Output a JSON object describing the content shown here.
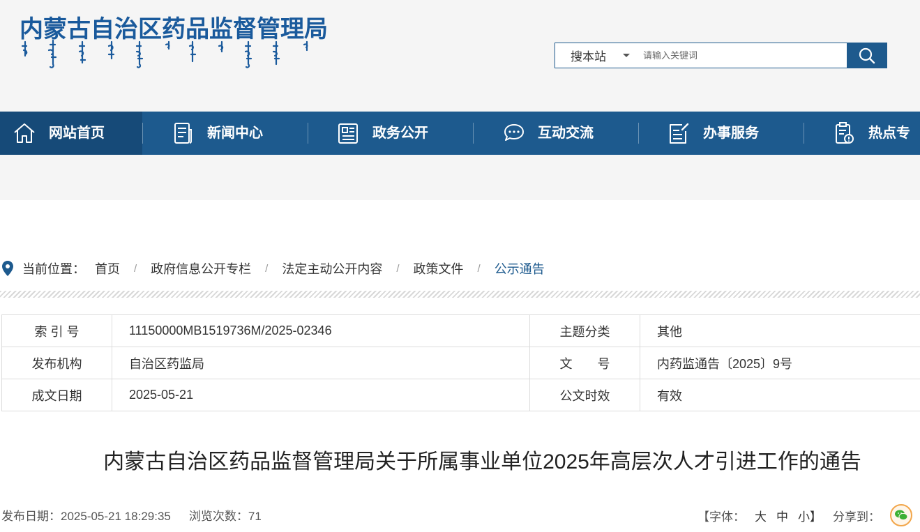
{
  "header": {
    "logo_text": "内蒙古自治区药品监督管理局",
    "search": {
      "scope_label": "搜本站",
      "placeholder": "请输入关键词"
    }
  },
  "nav": {
    "items": [
      {
        "label": "网站首页",
        "icon": "home-icon"
      },
      {
        "label": "新闻中心",
        "icon": "newspaper-icon"
      },
      {
        "label": "政务公开",
        "icon": "document-icon"
      },
      {
        "label": "互动交流",
        "icon": "chat-icon"
      },
      {
        "label": "办事服务",
        "icon": "edit-form-icon"
      },
      {
        "label": "热点专",
        "icon": "clipboard-alert-icon"
      }
    ]
  },
  "breadcrumb": {
    "label": "当前位置：",
    "items": [
      "首页",
      "政府信息公开专栏",
      "法定主动公开内容",
      "政策文件",
      "公示通告"
    ]
  },
  "info_table": {
    "rows": [
      {
        "k1": "索 引 号",
        "v1": "11150000MB1519736M/2025-02346",
        "k2": "主题分类",
        "v2": "其他"
      },
      {
        "k1": "发布机构",
        "v1": "自治区药监局",
        "k2": "文　　号",
        "v2": "内药监通告〔2025〕9号"
      },
      {
        "k1": "成文日期",
        "v1": "2025-05-21",
        "k2": "公文时效",
        "v2": "有效"
      }
    ]
  },
  "article": {
    "title": "内蒙古自治区药品监督管理局关于所属事业单位2025年高层次人才引进工作的通告",
    "publish_label": "发布日期：",
    "publish_value": "2025-05-21 18:29:35",
    "views_label": "浏览次数：",
    "views_value": "71"
  },
  "tools": {
    "font_label": "【字体：",
    "font_large": "大",
    "font_medium": "中",
    "font_small": "小】",
    "share_label": "分享到："
  },
  "colors": {
    "brand_blue": "#1d5a8e",
    "nav_active": "#164a78",
    "header_bg": "#f5f5f5"
  }
}
